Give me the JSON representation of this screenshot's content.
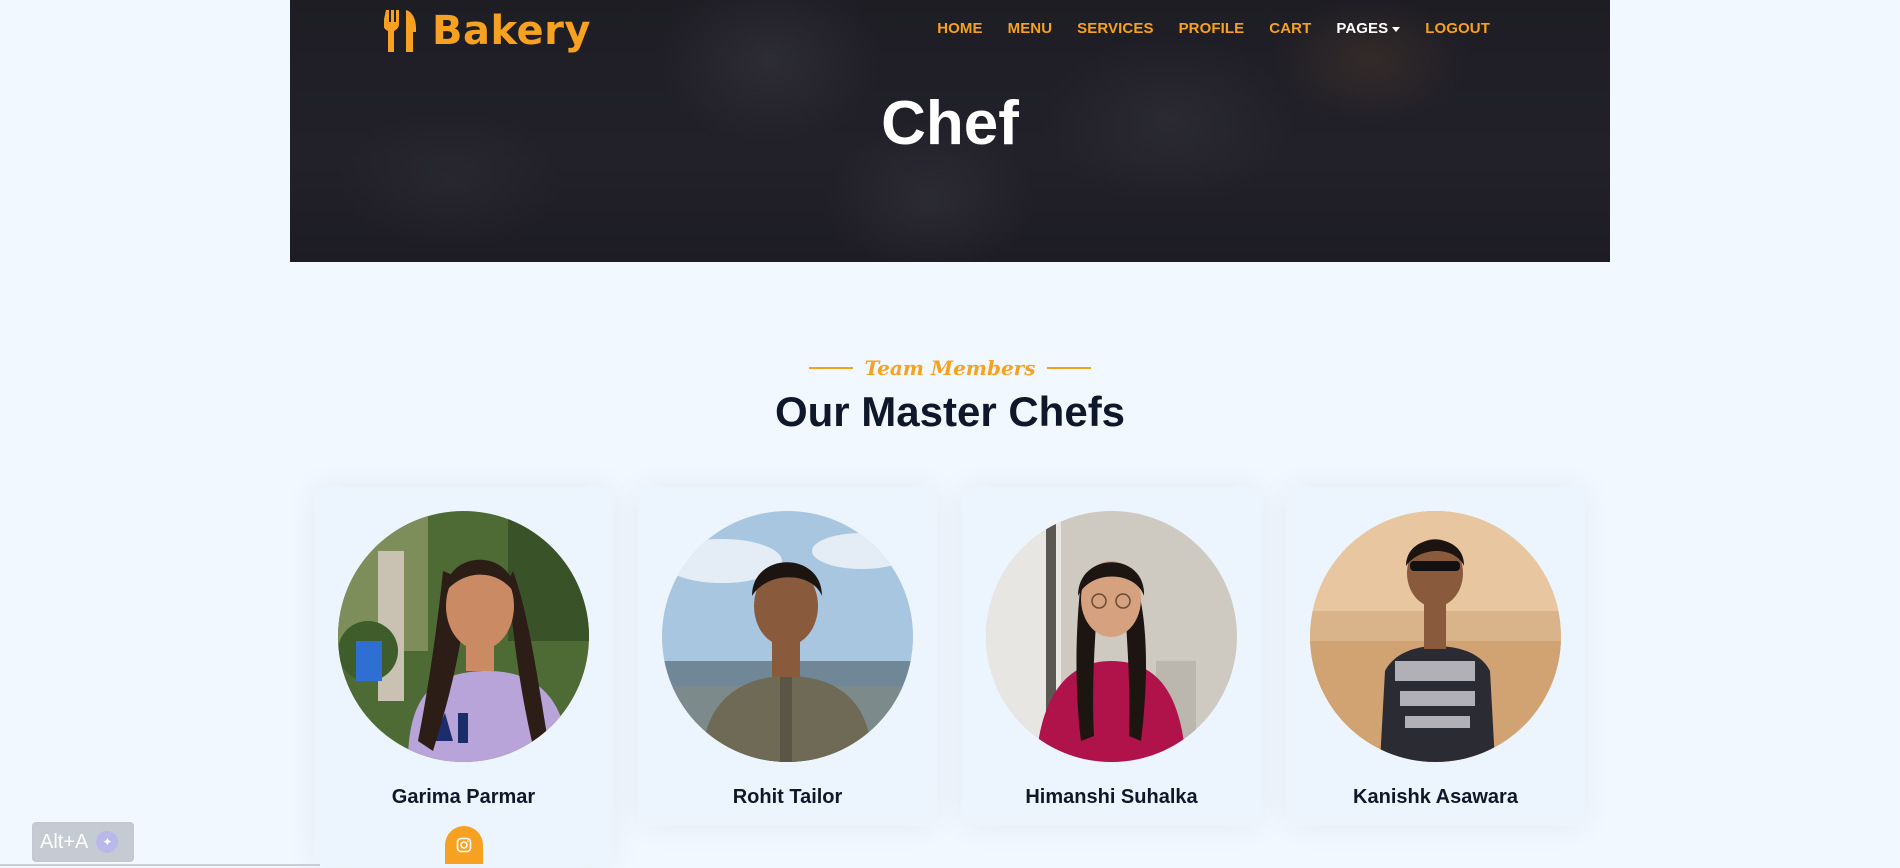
{
  "header": {
    "brand": "Bakery",
    "nav": [
      {
        "label": "HOME"
      },
      {
        "label": "MENU"
      },
      {
        "label": "SERVICES"
      },
      {
        "label": "PROFILE"
      },
      {
        "label": "CART"
      },
      {
        "label": "PAGES"
      },
      {
        "label": "LOGOUT"
      }
    ],
    "active_nav": "PAGES",
    "hero_title": "Chef"
  },
  "team": {
    "subtitle": "Team Members",
    "title": "Our Master Chefs",
    "chefs": [
      {
        "name": "Garima Parmar",
        "photo": "chef-photo"
      },
      {
        "name": "Rohit Tailor",
        "photo": "chef-photo"
      },
      {
        "name": "Himanshi Suhalka",
        "photo": "chef-photo"
      },
      {
        "name": "Kanishk Asawara",
        "photo": "chef-photo"
      }
    ],
    "social_icon": "instagram-icon"
  },
  "overlay": {
    "shortcut_label": "Alt+A"
  },
  "colors": {
    "accent": "#f6a121",
    "dark": "#0f172b",
    "page_bg": "#f1f8ff"
  }
}
